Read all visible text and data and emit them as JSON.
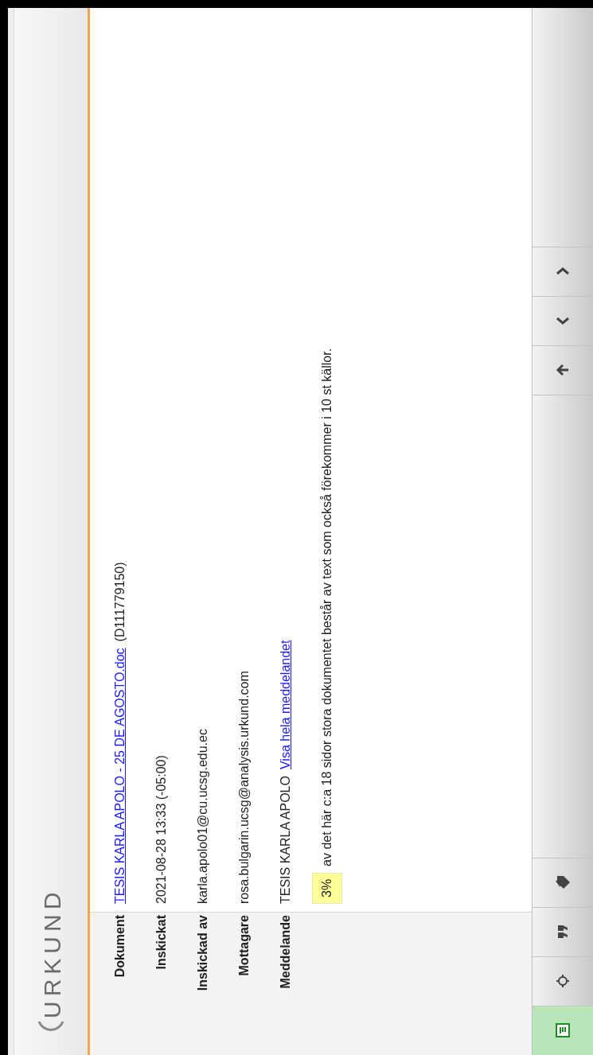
{
  "logo": {
    "text": "URKUND"
  },
  "fields": [
    {
      "label": "Dokument",
      "parts": [
        {
          "text": "TESIS KARLA APOLO - 25 DE AGOSTO.doc",
          "link": true
        },
        {
          "text": "(D111779150)",
          "link": false
        }
      ]
    },
    {
      "label": "Inskickat",
      "parts": [
        {
          "text": "2021-08-28 13:33 (-05:00)",
          "link": false
        }
      ]
    },
    {
      "label": "Inskickad av",
      "parts": [
        {
          "text": "karla.apolo01@cu.ucsg.edu.ec",
          "link": false
        }
      ]
    },
    {
      "label": "Mottagare",
      "parts": [
        {
          "text": "rosa.bulgarin.ucsg@analysis.urkund.com",
          "link": false
        }
      ]
    },
    {
      "label": "Meddelande",
      "parts": [
        {
          "text": "TESIS KARLA APOLO",
          "link": false
        },
        {
          "text": "Visa hela meddelandet",
          "link": true
        }
      ]
    }
  ],
  "summary": {
    "percent": "3%",
    "text": "av det här c:a 18 sidor stora dokumentet består av text som också förekommer i 10 st källor."
  },
  "toolbar_left": [
    {
      "kind": "overview",
      "selected": true
    },
    {
      "kind": "target",
      "selected": false
    },
    {
      "kind": "quote",
      "selected": false
    },
    {
      "kind": "tag",
      "selected": false
    }
  ],
  "toolbar_right": [
    {
      "kind": "back"
    },
    {
      "kind": "down"
    },
    {
      "kind": "up"
    }
  ]
}
